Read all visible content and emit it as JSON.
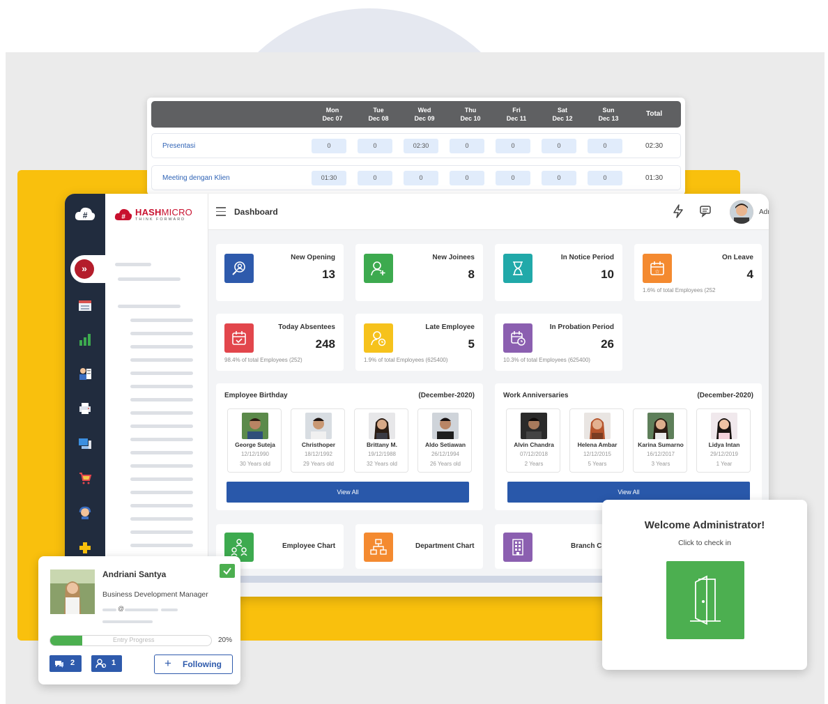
{
  "timesheet": {
    "days": [
      {
        "day": "Mon",
        "date": "Dec 07"
      },
      {
        "day": "Tue",
        "date": "Dec 08"
      },
      {
        "day": "Wed",
        "date": "Dec 09"
      },
      {
        "day": "Thu",
        "date": "Dec 10"
      },
      {
        "day": "Fri",
        "date": "Dec 11"
      },
      {
        "day": "Sat",
        "date": "Dec 12"
      },
      {
        "day": "Sun",
        "date": "Dec 13"
      }
    ],
    "total_label": "Total",
    "rows": [
      {
        "label": "Presentasi",
        "values": [
          "0",
          "0",
          "02:30",
          "0",
          "0",
          "0",
          "0"
        ],
        "total": "02:30"
      },
      {
        "label": "Meeting dengan Klien",
        "values": [
          "01:30",
          "0",
          "0",
          "0",
          "0",
          "0",
          "0"
        ],
        "total": "01:30"
      }
    ]
  },
  "app": {
    "brand_name_bold": "HASH",
    "brand_name_light": "MICRO",
    "brand_tagline": "THINK FORWARD",
    "page_title": "Dashboard",
    "user_name": "Administrator",
    "accent": "#c8102e",
    "rail_bg": "#212c3e"
  },
  "kpis": [
    {
      "title": "New Opening",
      "value": "13",
      "sub": "",
      "color": "#2e5aac",
      "icon": "search-user-icon"
    },
    {
      "title": "New Joinees",
      "value": "8",
      "sub": "",
      "color": "#3daa4f",
      "icon": "user-add-icon"
    },
    {
      "title": "In Notice Period",
      "value": "10",
      "sub": "",
      "color": "#21a9a9",
      "icon": "hourglass-icon"
    },
    {
      "title": "On Leave",
      "value": "4",
      "sub": "1.6% of total Employees (252",
      "color": "#f48a30",
      "icon": "calendar-star-icon"
    },
    {
      "title": "Today Absentees",
      "value": "248",
      "sub": "98.4% of total Employees (252)",
      "color": "#e2464c",
      "icon": "calendar-check-icon"
    },
    {
      "title": "Late Employee",
      "value": "5",
      "sub": "1.9% of total Employees (625400)",
      "color": "#f6c21c",
      "icon": "user-clock-icon"
    },
    {
      "title": "In Probation Period",
      "value": "26",
      "sub": "10.3% of total Employees (625400)",
      "color": "#8b5fb0",
      "icon": "calendar-clock-icon"
    }
  ],
  "birthday": {
    "title": "Employee Birthday",
    "period": "(December-2020)",
    "view_all": "View All",
    "people": [
      {
        "name": "George Suteja",
        "date": "12/12/1990",
        "age": "30 Years old"
      },
      {
        "name": "Christhoper",
        "date": "18/12/1992",
        "age": "29 Years old"
      },
      {
        "name": "Brittany M.",
        "date": "19/12/1988",
        "age": "32 Years old"
      },
      {
        "name": "Aldo Setiawan",
        "date": "26/12/1994",
        "age": "26 Years old"
      }
    ]
  },
  "anniversary": {
    "title": "Work Anniversaries",
    "period": "(December-2020)",
    "view_all": "View All",
    "people": [
      {
        "name": "Alvin Chandra",
        "date": "07/12/2018",
        "age": "2 Years"
      },
      {
        "name": "Helena Ambar",
        "date": "12/12/2015",
        "age": "5 Years"
      },
      {
        "name": "Karina Sumarno",
        "date": "16/12/2017",
        "age": "3 Years"
      },
      {
        "name": "Lidya Intan",
        "date": "29/12/2019",
        "age": "1 Year"
      }
    ]
  },
  "charts": [
    {
      "label": "Employee Chart",
      "color": "#3daa4f",
      "icon": "org-people-icon"
    },
    {
      "label": "Department Chart",
      "color": "#f48a30",
      "icon": "hierarchy-icon"
    },
    {
      "label": "Branch Ch",
      "color": "#8b5fb0",
      "icon": "building-icon"
    }
  ],
  "profile": {
    "name": "Andriani Santya",
    "role": "Business Development Manager",
    "email_at": "@",
    "progress_label": "Entry Progress",
    "progress_pct": "20%",
    "progress_fraction": 0.2,
    "messages_count": "2",
    "followers_count": "1",
    "follow_label": "Following",
    "badge_color": "#2e5aac"
  },
  "welcome": {
    "title": "Welcome Administrator!",
    "subtitle": "Click to check in",
    "button_color": "#4caf50"
  }
}
